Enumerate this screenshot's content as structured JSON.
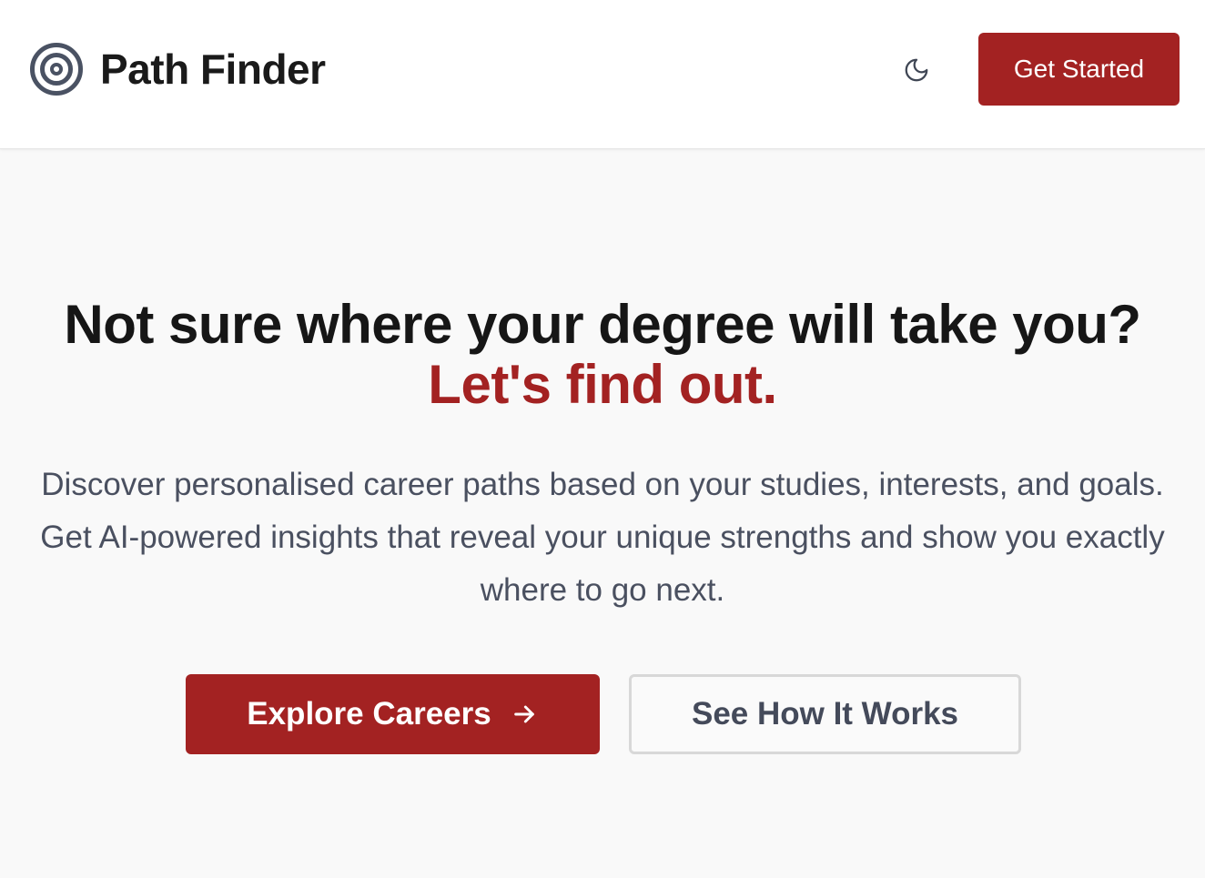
{
  "header": {
    "brand_name": "Path Finder",
    "brand_icon": "target-icon",
    "theme_toggle_icon": "moon-icon",
    "get_started_label": "Get Started"
  },
  "hero": {
    "headline": "Not sure where your degree will take you?",
    "headline_accent": "Let's find out.",
    "subtext": "Discover personalised career paths based on your studies, interests, and goals. Get AI-powered insights that reveal your unique strengths and show you exactly where to go next.",
    "primary_cta_label": "Explore Careers",
    "primary_cta_icon": "arrow-right-icon",
    "secondary_cta_label": "See How It Works"
  },
  "colors": {
    "accent": "#a32222",
    "background": "#f9f9f9",
    "header_background": "#ffffff",
    "heading_text": "#161616",
    "body_text": "#4a5060"
  }
}
